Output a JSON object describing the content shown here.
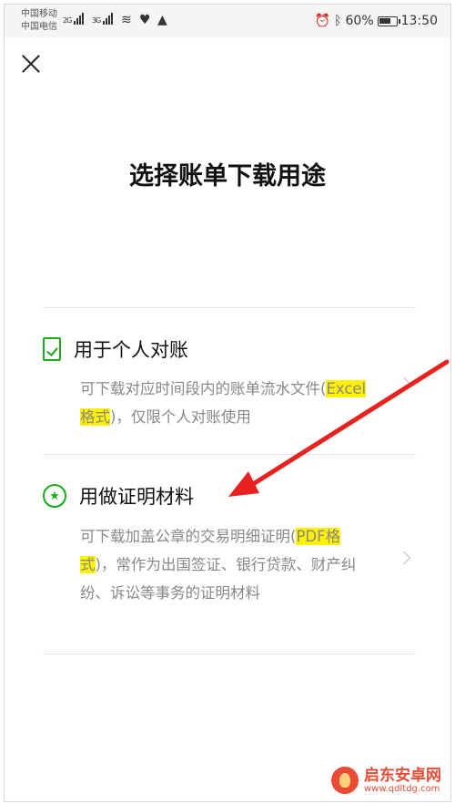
{
  "status_bar": {
    "carrier_1": "中国移动",
    "carrier_2": "中国电信",
    "net_1": "2G",
    "net_2": "3G",
    "battery": "60%",
    "time": "13:50"
  },
  "page": {
    "title": "选择账单下载用途"
  },
  "options": [
    {
      "title": "用于个人对账",
      "desc_before": "可下载对应时间段内的账单流水文件(",
      "desc_highlight": "Excel格式",
      "desc_after": ")，仅限个人对账使用",
      "icon": "document-check-icon"
    },
    {
      "title": "用做证明材料",
      "desc_before": "可下载加盖公章的交易明细证明(",
      "desc_highlight": "PDF格式",
      "desc_after": ")，常作为出国签证、银行贷款、财产纠纷、诉讼等事务的证明材料",
      "icon": "star-badge-icon"
    }
  ],
  "watermark": {
    "name": "启东安卓网",
    "url": "www.qdltdg.com"
  },
  "colors": {
    "accent": "#1aad19",
    "highlight": "#fff200",
    "annotation_arrow": "#e8231f"
  }
}
